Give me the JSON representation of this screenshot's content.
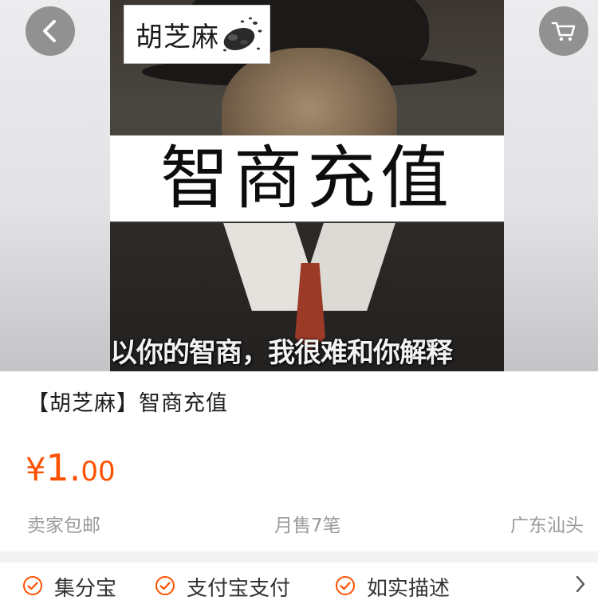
{
  "nav": {
    "back_icon": "chevron-left-icon",
    "cart_icon": "shopping-cart-icon"
  },
  "image": {
    "logo_text": "胡芝麻",
    "banner_text": "智商充值",
    "caption": "以你的智商，我很难和你解释"
  },
  "product": {
    "title": "【胡芝麻】智商充值",
    "price_symbol": "¥",
    "price_integer": "1.",
    "price_decimal": "00",
    "shipping": "卖家包邮",
    "monthly_sales": "月售7笔",
    "location": "广东汕头"
  },
  "services": [
    {
      "label": "集分宝",
      "icon": "check-circle-icon"
    },
    {
      "label": "支付宝支付",
      "icon": "check-circle-icon"
    },
    {
      "label": "如实描述",
      "icon": "check-circle-icon"
    }
  ],
  "colors": {
    "price": "#ff5000",
    "service_icon": "#ff5000",
    "muted_text": "#9a9a9a"
  }
}
